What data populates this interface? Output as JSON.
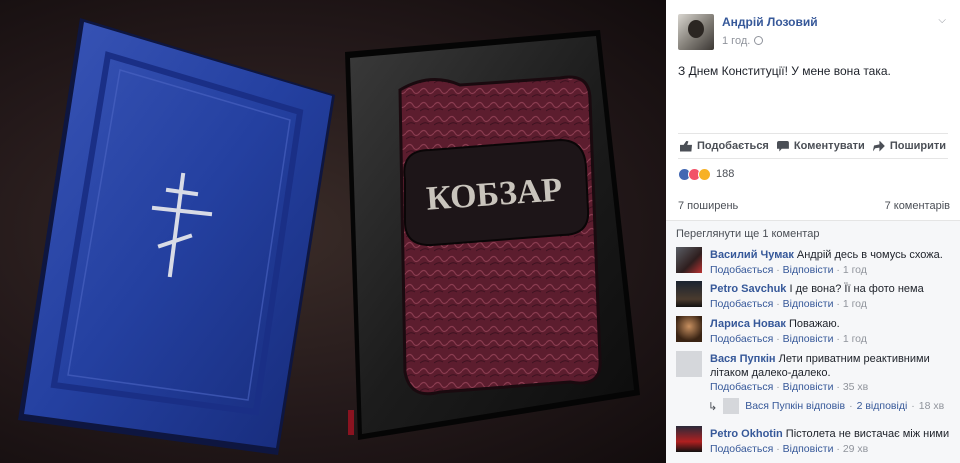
{
  "post": {
    "author": "Андрій Лозовий",
    "time": "1 год.",
    "text": "З Днем Конституції! У мене вона така."
  },
  "actions": {
    "like": "Подобається",
    "comment": "Коментувати",
    "share": "Поширити"
  },
  "reactions": {
    "count": "188"
  },
  "counts": {
    "shares": "7 поширень",
    "comments": "7 коментарів"
  },
  "photo": {
    "book_title": "КОБЗАР"
  },
  "comments_section": {
    "more": "Переглянути ще 1 коментар",
    "like_label": "Подобається",
    "reply_label": "Відповісти",
    "items": [
      {
        "name": "Василий Чумак",
        "text": "Андрій десь в чомусь схожа.",
        "time": "1 год"
      },
      {
        "name": "Petro Savchuk",
        "text": "І де вона? Її на фото нема",
        "time": "1 год"
      },
      {
        "name": "Лариса Новак",
        "text": "Поважаю.",
        "time": "1 год"
      },
      {
        "name": "Вася Пупкін",
        "text": "Лети приватним реактивними літаком далеко-далеко.",
        "time": "35 хв"
      },
      {
        "name": "Petro Okhotin",
        "text": "Пістолета не вистачає між ними",
        "time": "29 хв"
      }
    ],
    "reply": {
      "text": "Вася Пупкін відповів",
      "replies": "2 відповіді",
      "time": "18 хв"
    }
  }
}
